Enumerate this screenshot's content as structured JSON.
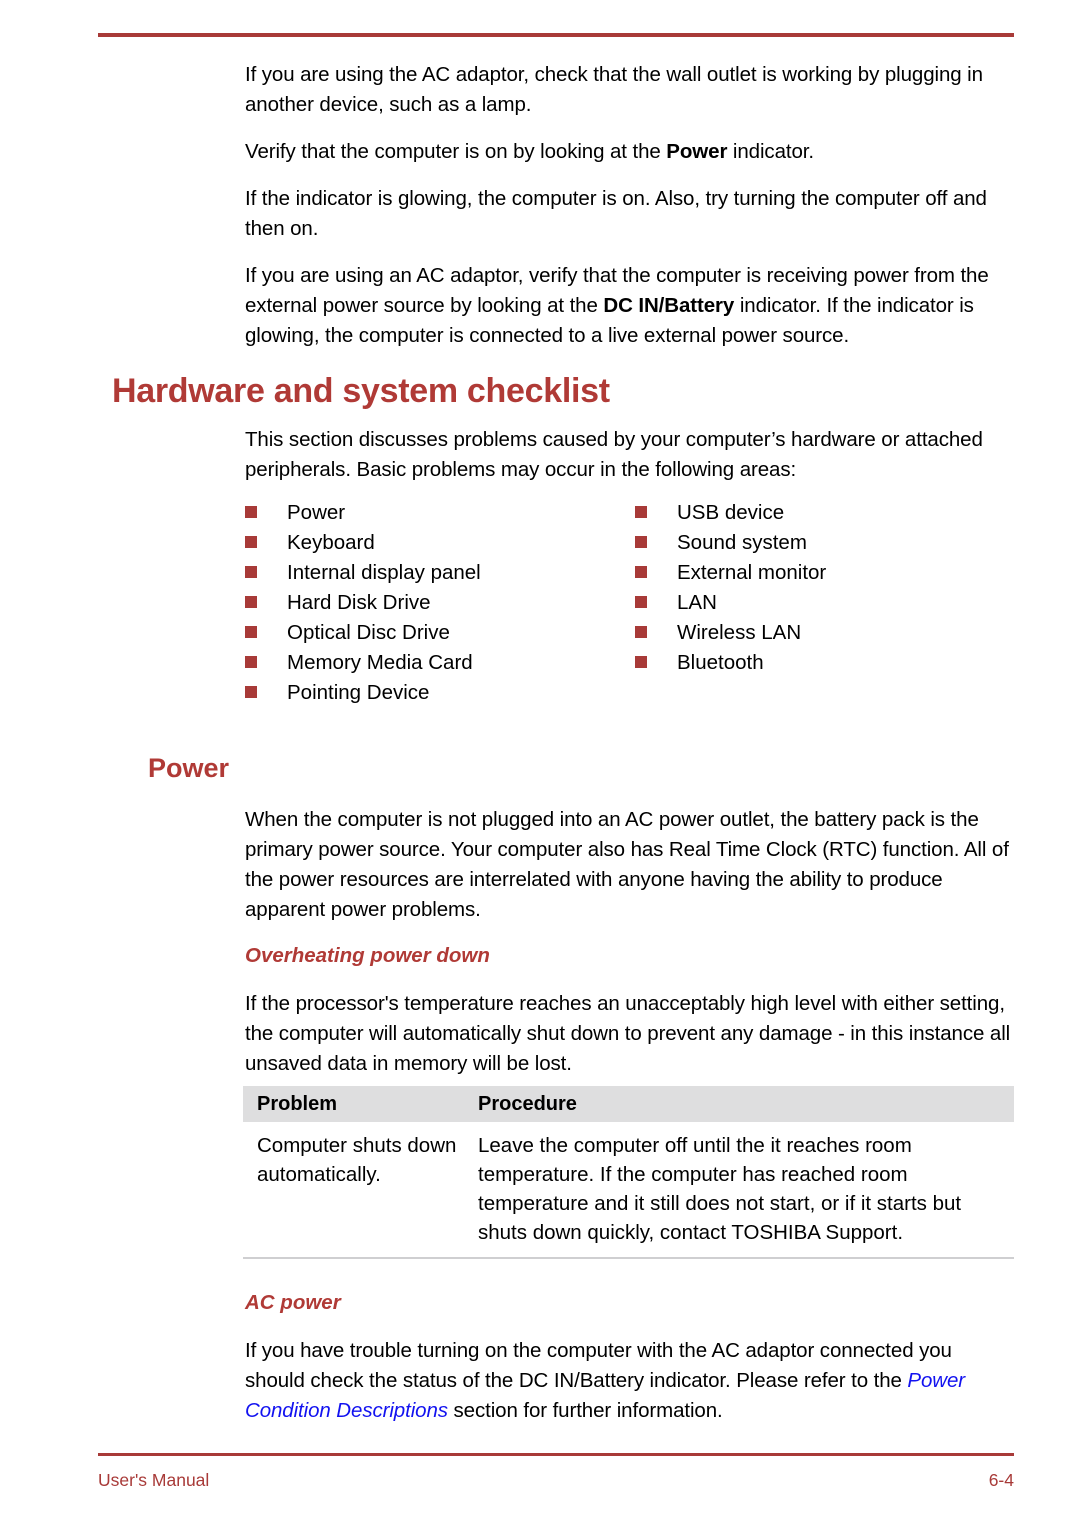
{
  "theme": {
    "accent_red": "#b03a36",
    "rule_red": "#a83a38",
    "bullet_red": "#a83a38",
    "table_header_bg": "#dededf",
    "link_blue": "#1212f0"
  },
  "intro_paragraphs": [
    {
      "id": "p1",
      "segments": [
        {
          "text": "If you are using the AC adaptor, check that the wall outlet is working by plugging in another device, such as a lamp.",
          "style": "normal"
        }
      ]
    },
    {
      "id": "p2",
      "segments": [
        {
          "text": "Verify that the computer is on by looking at the ",
          "style": "normal"
        },
        {
          "text": "Power",
          "style": "bold"
        },
        {
          "text": " indicator.",
          "style": "normal"
        }
      ]
    },
    {
      "id": "p3",
      "segments": [
        {
          "text": "If the indicator is glowing, the computer is on. Also, try turning the computer off and then on.",
          "style": "normal"
        }
      ]
    },
    {
      "id": "p4",
      "segments": [
        {
          "text": "If you are using an AC adaptor, verify that the computer is receiving power from the external power source by looking at the ",
          "style": "normal"
        },
        {
          "text": "DC IN/Battery",
          "style": "bold"
        },
        {
          "text": " indicator. If the indicator is glowing, the computer is connected to a live external power source.",
          "style": "normal"
        }
      ]
    }
  ],
  "section_checklist": {
    "heading": "Hardware and system checklist",
    "intro": "This section discusses problems caused by your computer’s hardware or attached peripherals. Basic problems may occur in the following areas:",
    "bullets_left": [
      "Power",
      "Keyboard",
      "Internal display panel",
      "Hard Disk Drive",
      "Optical Disc Drive",
      "Memory Media Card",
      "Pointing Device"
    ],
    "bullets_right": [
      "USB device",
      "Sound system",
      "External monitor",
      "LAN",
      "Wireless LAN",
      "Bluetooth"
    ]
  },
  "section_power": {
    "heading": "Power",
    "paragraph": "When the computer is not plugged into an AC power outlet, the battery pack is the primary power source. Your computer also has Real Time Clock (RTC) function. All of the power resources are interrelated with anyone having the ability to produce apparent power problems."
  },
  "section_overheating": {
    "heading": "Overheating power down",
    "paragraph": "If the processor's temperature reaches an unacceptably high level with either setting, the computer will automatically shut down to prevent any damage - in this instance all unsaved data in memory will be lost.",
    "table": {
      "columns": [
        "Problem",
        "Procedure"
      ],
      "rows": [
        {
          "problem": "Computer shuts down automatically.",
          "procedure": "Leave the computer off until the it reaches room temperature. If the computer has reached room temperature and it still does not start, or if it starts but shuts down quickly, contact TOSHIBA Support."
        }
      ]
    }
  },
  "section_ac_power": {
    "heading": "AC power",
    "paragraph_before_link": "If you have trouble turning on the computer with the AC adaptor connected you should check the status of the DC IN/Battery indicator. Please refer to the ",
    "link_text": "Power Condition Descriptions",
    "paragraph_after_link": " section for further information."
  },
  "footer": {
    "left": "User's Manual",
    "right": "6-4"
  }
}
